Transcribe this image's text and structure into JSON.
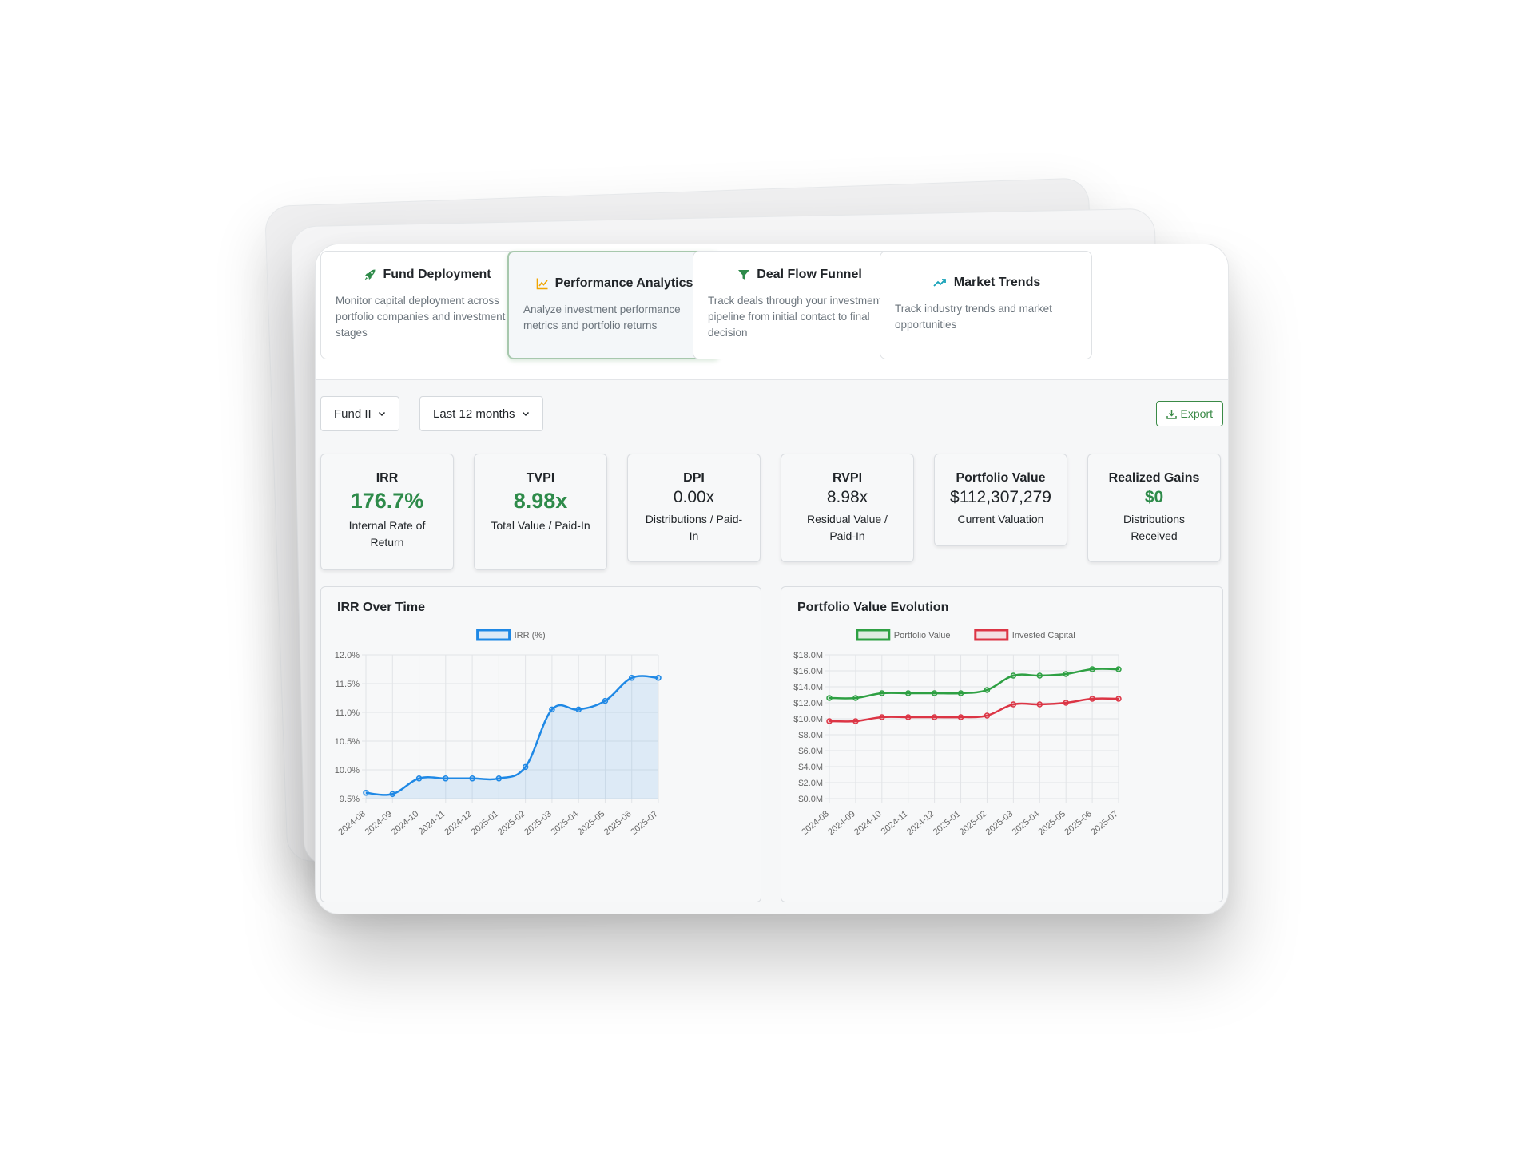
{
  "tabs": [
    {
      "title": "Fund Deployment",
      "icon": "rocket-icon",
      "icon_color": "#2e8b4a",
      "description": "Monitor capital deployment across portfolio companies and investment stages",
      "active": false
    },
    {
      "title": "Performance Analytics",
      "icon": "chart-line-icon",
      "icon_color": "#f0a500",
      "description": "Analyze investment performance metrics and portfolio returns",
      "active": true
    },
    {
      "title": "Deal Flow Funnel",
      "icon": "funnel-icon",
      "icon_color": "#2e8b4a",
      "description": "Track deals through your investment pipeline from initial contact to final decision",
      "active": false
    },
    {
      "title": "Market Trends",
      "icon": "trending-up-icon",
      "icon_color": "#17a2b8",
      "description": "Track industry trends and market opportunities",
      "active": false
    }
  ],
  "filters": {
    "fund": "Fund II",
    "period": "Last 12 months",
    "export_label": "Export"
  },
  "kpis": [
    {
      "label": "IRR",
      "value": "176.7%",
      "sub": "Internal Rate of Return",
      "highlight": true
    },
    {
      "label": "TVPI",
      "value": "8.98x",
      "sub": "Total Value / Paid-In",
      "highlight": true
    },
    {
      "label": "DPI",
      "value": "0.00x",
      "sub": "Distributions / Paid-In",
      "highlight": false
    },
    {
      "label": "RVPI",
      "value": "8.98x",
      "sub": "Residual Value / Paid-In",
      "highlight": false
    },
    {
      "label": "Portfolio Value",
      "value": "$112,307,279",
      "sub": "Current Valuation",
      "highlight": false
    },
    {
      "label": "Realized Gains",
      "value": "$0",
      "sub": "Distributions Received",
      "highlight": true
    }
  ],
  "colors": {
    "accent_green": "#2e8b4a",
    "irr_line": "#1e88e5",
    "portfolio_line": "#2ea043",
    "invested_line": "#dc3545"
  },
  "chart_data": [
    {
      "type": "area",
      "title": "IRR Over Time",
      "categories": [
        "2024-08",
        "2024-09",
        "2024-10",
        "2024-11",
        "2024-12",
        "2025-01",
        "2025-02",
        "2025-03",
        "2025-04",
        "2025-05",
        "2025-06",
        "2025-07"
      ],
      "series": [
        {
          "name": "IRR (%)",
          "values": [
            9.6,
            9.58,
            9.85,
            9.85,
            9.85,
            9.85,
            10.05,
            11.05,
            11.05,
            11.2,
            11.6,
            11.6
          ]
        }
      ],
      "ylim": [
        9.5,
        12.0
      ],
      "yticks": [
        "12.0%",
        "11.5%",
        "11.0%",
        "10.5%",
        "10.0%",
        "9.5%"
      ],
      "legend": "top",
      "grid": true
    },
    {
      "type": "line",
      "title": "Portfolio Value Evolution",
      "categories": [
        "2024-08",
        "2024-09",
        "2024-10",
        "2024-11",
        "2024-12",
        "2025-01",
        "2025-02",
        "2025-03",
        "2025-04",
        "2025-05",
        "2025-06",
        "2025-07"
      ],
      "series": [
        {
          "name": "Portfolio Value",
          "values": [
            12.6,
            12.6,
            13.2,
            13.2,
            13.2,
            13.2,
            13.6,
            15.4,
            15.4,
            15.6,
            16.2,
            16.2
          ]
        },
        {
          "name": "Invested Capital",
          "values": [
            9.7,
            9.7,
            10.2,
            10.2,
            10.2,
            10.2,
            10.4,
            11.8,
            11.8,
            12.0,
            12.5,
            12.5
          ]
        }
      ],
      "ylim": [
        0,
        18
      ],
      "yticks": [
        "$18.0M",
        "$16.0M",
        "$14.0M",
        "$12.0M",
        "$10.0M",
        "$8.0M",
        "$6.0M",
        "$4.0M",
        "$2.0M",
        "$0.0M"
      ],
      "legend": "top",
      "grid": true
    }
  ]
}
